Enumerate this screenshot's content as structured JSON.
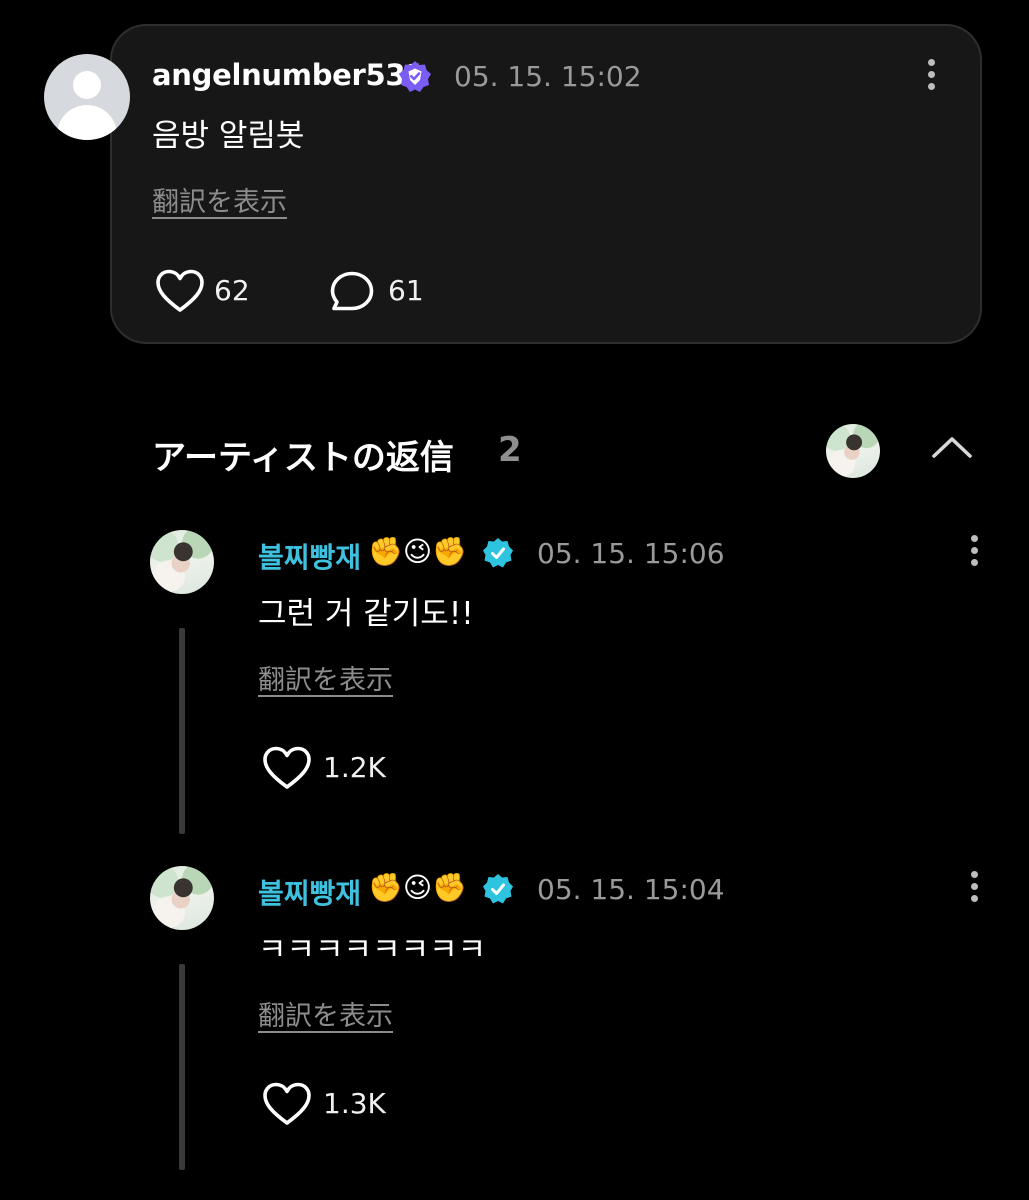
{
  "post": {
    "username": "angelnumber531",
    "timestamp": "05. 15. 15:02",
    "text": "음방 알림봇",
    "translate_label": "翻訳を表示",
    "likes": "62",
    "comments": "61"
  },
  "artist_replies": {
    "title": "アーティストの返信",
    "count": "2",
    "replies": [
      {
        "username": "볼찌빵재",
        "emojis": "✊😉✊",
        "timestamp": "05. 15. 15:06",
        "text": "그런 거 같기도!!",
        "translate_label": "翻訳を表示",
        "likes": "1.2K"
      },
      {
        "username": "볼찌빵재",
        "emojis": "✊😉✊",
        "timestamp": "05. 15. 15:04",
        "text": "ㅋㅋㅋㅋㅋㅋㅋㅋ",
        "translate_label": "翻訳を表示",
        "likes": "1.3K"
      }
    ]
  },
  "colors": {
    "background": "#000000",
    "card": "#171717",
    "artist_name": "#3ec2e0",
    "verified_user": "#7b5cf5",
    "verified_artist": "#2ec4e0",
    "muted_text": "#9a9a9a"
  }
}
